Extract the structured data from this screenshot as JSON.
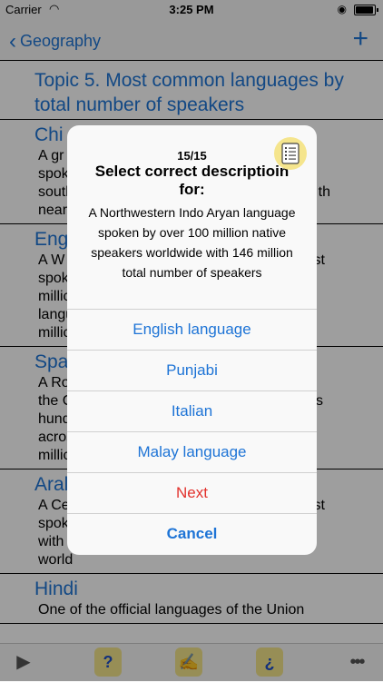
{
  "status_bar": {
    "carrier": "Carrier",
    "time": "3:25 PM"
  },
  "nav": {
    "back_label": "Geography"
  },
  "list": {
    "topic": "Topic 5. Most common languages by total number of speakers",
    "items": [
      {
        "title": "Chi",
        "lines": [
          "A gr",
          "spok",
          "south",
          "near"
        ],
        "right_tail": "th"
      },
      {
        "title": "Eng",
        "lines": [
          "A W",
          "spok",
          "millic",
          "langu",
          "millic"
        ],
        "right_tail": "st"
      },
      {
        "title": "Spa",
        "lines": [
          "A Ro",
          "the C",
          "hund",
          "acros",
          "millic"
        ],
        "right_tail": "s"
      },
      {
        "title": "Aral",
        "lines": [
          "A Ce",
          "spok",
          "with 385 million of total speakers in the",
          "world"
        ],
        "right_tail": "st"
      },
      {
        "title": "Hindi",
        "lines": [
          "One of the official languages of the Union"
        ]
      }
    ]
  },
  "dialog": {
    "counter": "15/15",
    "heading": "Select correct descriptioin for:",
    "question": "A Northwestern Indo Aryan language spoken by over 100 million native speakers worldwide with 146 million total number of speakers",
    "icon": "checklist-icon",
    "options": [
      "English language",
      "Punjabi",
      "Italian",
      "Malay language"
    ],
    "next_label": "Next",
    "cancel_label": "Cancel"
  },
  "toolbar": {
    "help_label": "?",
    "inverse_label": "¿"
  },
  "colors": {
    "accent": "#1e74d6",
    "danger": "#e2322d",
    "highlight": "#f4e58c"
  }
}
